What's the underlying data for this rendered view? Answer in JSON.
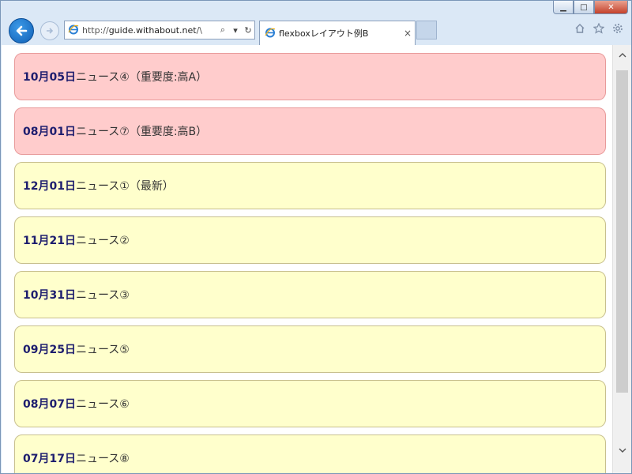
{
  "browser": {
    "url_prefix": "http://",
    "url_host": "guide.withabout.net",
    "url_suffix": "/\\",
    "search_glyph": "⌕",
    "dropdown_glyph": "▾",
    "refresh_glyph": "↻",
    "tab_title": "flexboxレイアウト例B",
    "tab_close": "×"
  },
  "window_controls": {
    "minimize": "▁",
    "maximize": "□",
    "close": "✕"
  },
  "icons": {
    "back": "back-arrow-icon",
    "forward": "forward-arrow-icon",
    "ie": "ie-logo-icon",
    "home": "home-icon",
    "favorites": "star-icon",
    "settings": "gear-icon"
  },
  "colors": {
    "important_bg": "#ffcccc",
    "important_border": "#e89a9a",
    "normal_bg": "#ffffcc",
    "normal_border": "#c8c08e",
    "date_text": "#1d1d6e"
  },
  "news": [
    {
      "date": "10月05日",
      "text": "ニュース④（重要度:高A）",
      "important": true
    },
    {
      "date": "08月01日",
      "text": "ニュース⑦（重要度:高B）",
      "important": true
    },
    {
      "date": "12月01日",
      "text": "ニュース①（最新）",
      "important": false
    },
    {
      "date": "11月21日",
      "text": "ニュース②",
      "important": false
    },
    {
      "date": "10月31日",
      "text": "ニュース③",
      "important": false
    },
    {
      "date": "09月25日",
      "text": "ニュース⑤",
      "important": false
    },
    {
      "date": "08月07日",
      "text": "ニュース⑥",
      "important": false
    },
    {
      "date": "07月17日",
      "text": "ニュース⑧",
      "important": false
    }
  ]
}
